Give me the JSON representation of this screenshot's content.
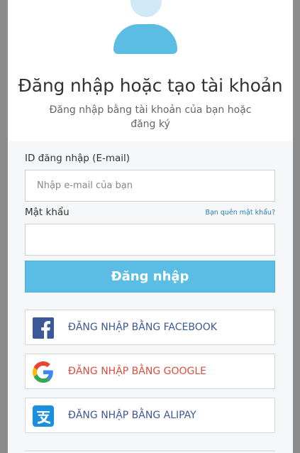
{
  "header": {
    "title": "Đăng nhập hoặc tạo tài khoản",
    "subtitle": "Đăng nhập bằng tài khoản của bạn hoặc đăng ký"
  },
  "form": {
    "email_label": "ID đăng nhập (E-mail)",
    "email_placeholder": "Nhập e-mail của bạn",
    "email_value": "",
    "password_label": "Mật khẩu",
    "password_value": "",
    "forgot_link": "Bạn quên mật khẩu?",
    "login_button": "Đăng nhập"
  },
  "social": [
    {
      "label": "ĐĂNG NHẬP BẰNG FACEBOOK",
      "icon": "facebook-icon",
      "color": "#3b5998"
    },
    {
      "label": "ĐĂNG NHẬP BẰNG GOOGLE",
      "icon": "google-icon",
      "color": "#dc4e41"
    },
    {
      "label": "ĐĂNG NHẬP BẰNG ALIPAY",
      "icon": "alipay-icon",
      "color": "#3b5998"
    }
  ],
  "colors": {
    "accent": "#5bbde3",
    "facebook": "#3b5998",
    "google_text": "#dc4e41",
    "alipay": "#1a8fe0"
  }
}
